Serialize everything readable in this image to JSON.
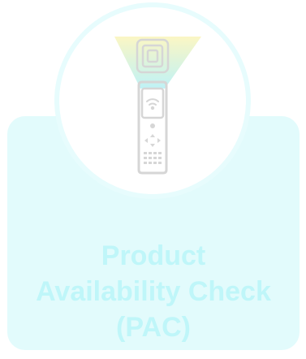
{
  "card": {
    "title": "Product\nAvailability Check\n(PAC)"
  },
  "icons": {
    "illustration": "handheld-rfid-scanner-icon",
    "tag": "rfid-tag-icon",
    "beam": "scan-beam-icon",
    "wifi": "wireless-signal-icon"
  },
  "colors": {
    "card_background": "#e2fbfc",
    "title_text": "#bff6f9",
    "ring": "#e7fcfd",
    "beam_top": "#fbf6c4",
    "beam_bottom": "#bff2f6",
    "device_outline": "#d6d6d6"
  }
}
